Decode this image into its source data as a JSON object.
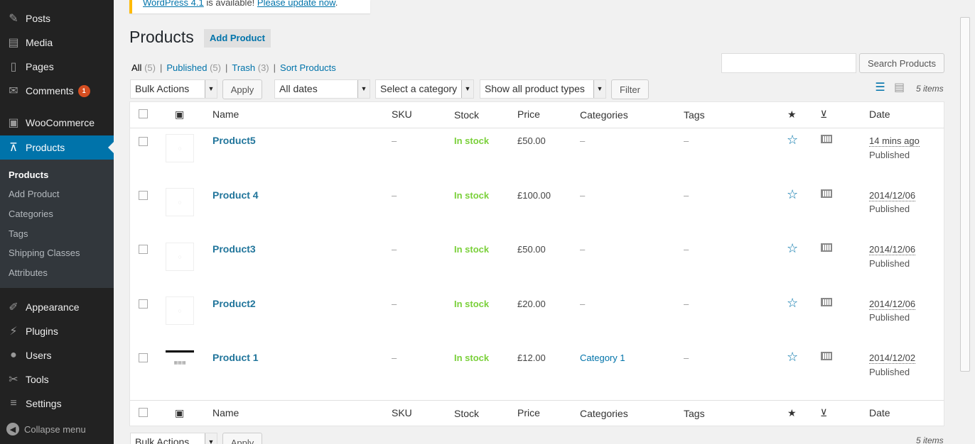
{
  "sidebar": {
    "items": [
      {
        "label": "Posts",
        "icon": "pin-icon",
        "glyph": "✎"
      },
      {
        "label": "Media",
        "icon": "media-icon",
        "glyph": "▤"
      },
      {
        "label": "Pages",
        "icon": "pages-icon",
        "glyph": "▯"
      },
      {
        "label": "Comments",
        "icon": "comments-icon",
        "glyph": "✉",
        "badge": "1"
      },
      {
        "label": "WooCommerce",
        "icon": "woo-icon",
        "glyph": "▣"
      },
      {
        "label": "Products",
        "icon": "cart-icon",
        "glyph": "⊼"
      },
      {
        "label": "Appearance",
        "icon": "brush-icon",
        "glyph": "✐"
      },
      {
        "label": "Plugins",
        "icon": "plug-icon",
        "glyph": "⚡"
      },
      {
        "label": "Users",
        "icon": "user-icon",
        "glyph": "●"
      },
      {
        "label": "Tools",
        "icon": "wrench-icon",
        "glyph": "✂"
      },
      {
        "label": "Settings",
        "icon": "settings-icon",
        "glyph": "≡"
      }
    ],
    "submenu": [
      "Products",
      "Add Product",
      "Categories",
      "Tags",
      "Shipping Classes",
      "Attributes"
    ],
    "collapse": "Collapse menu"
  },
  "notice": {
    "link1": "WordPress 4.1",
    "text": " is available! ",
    "link2": "Please update now",
    "end": "."
  },
  "header": {
    "title": "Products",
    "add_label": "Add Product"
  },
  "filters": {
    "all": "All",
    "all_count": "(5)",
    "published": "Published",
    "published_count": "(5)",
    "trash": "Trash",
    "trash_count": "(3)",
    "sort": "Sort Products",
    "sep": "|"
  },
  "search": {
    "button": "Search Products",
    "value": ""
  },
  "toolbar": {
    "bulk": "Bulk Actions",
    "apply": "Apply",
    "dates": "All dates",
    "category": "Select a category",
    "types": "Show all product types",
    "filter": "Filter",
    "items": "5 items"
  },
  "columns": {
    "name": "Name",
    "sku": "SKU",
    "stock": "Stock",
    "price": "Price",
    "categories": "Categories",
    "tags": "Tags",
    "date": "Date"
  },
  "rows": [
    {
      "name": "Product5",
      "sku": "–",
      "stock": "In stock",
      "price": "£50.00",
      "category": "–",
      "tags": "–",
      "date": "14 mins ago",
      "status": "Published"
    },
    {
      "name": "Product 4",
      "sku": "–",
      "stock": "In stock",
      "price": "£100.00",
      "category": "–",
      "tags": "–",
      "date": "2014/12/06",
      "status": "Published"
    },
    {
      "name": "Product3",
      "sku": "–",
      "stock": "In stock",
      "price": "£50.00",
      "category": "–",
      "tags": "–",
      "date": "2014/12/06",
      "status": "Published"
    },
    {
      "name": "Product2",
      "sku": "–",
      "stock": "In stock",
      "price": "£20.00",
      "category": "–",
      "tags": "–",
      "date": "2014/12/06",
      "status": "Published"
    },
    {
      "name": "Product 1",
      "sku": "–",
      "stock": "In stock",
      "price": "£12.00",
      "category": "Category 1",
      "tags": "–",
      "date": "2014/12/02",
      "status": "Published"
    }
  ],
  "colors": {
    "accent": "#0073aa",
    "sidebar": "#222222",
    "stock": "#7ad03a",
    "badge": "#d54e21"
  }
}
